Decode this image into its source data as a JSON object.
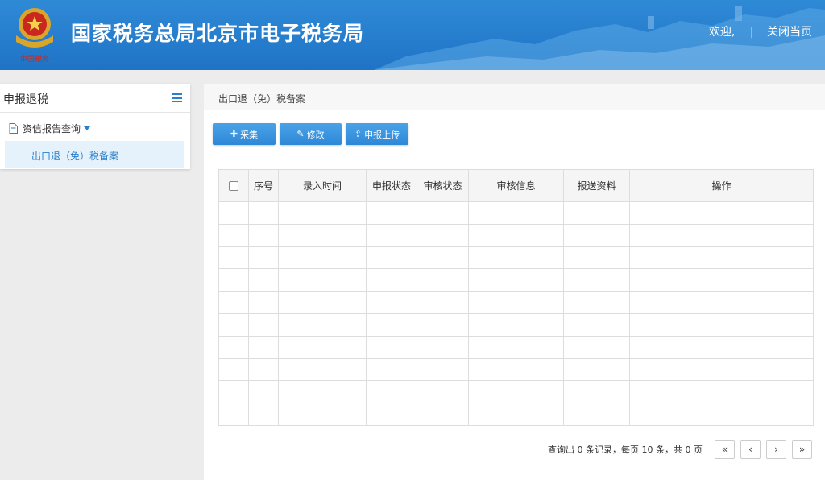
{
  "header": {
    "title": "国家税务总局北京市电子税务局",
    "welcome": "欢迎,",
    "separator": "|",
    "close_page": "关闭当页",
    "emblem_text": "中国税务",
    "bg_color": "#2f8ad6"
  },
  "sidebar": {
    "title": "申报退税",
    "menu_icon": "hamburger-icon",
    "group": {
      "icon": "document-icon",
      "label": "资信报告查询"
    },
    "active_item": {
      "label": "出口退（免）税备案"
    }
  },
  "main": {
    "breadcrumb": "出口退（免）税备案",
    "toolbar": {
      "add": {
        "label": "采集",
        "icon": "plus-icon"
      },
      "edit": {
        "label": "修改",
        "icon": "edit-icon"
      },
      "upload": {
        "label": "申报上传",
        "icon": "upload-icon"
      }
    },
    "table": {
      "columns": [
        "序号",
        "录入时间",
        "申报状态",
        "审核状态",
        "审核信息",
        "报送资料",
        "操作"
      ],
      "rows": []
    },
    "pager": {
      "info": "查询出 0 条记录，每页 10 条，共 0 页",
      "first": "«",
      "prev": "‹",
      "next": "›",
      "last": "»"
    }
  },
  "colors": {
    "accent": "#2a80cc",
    "active_bg": "#e5f1fb"
  }
}
